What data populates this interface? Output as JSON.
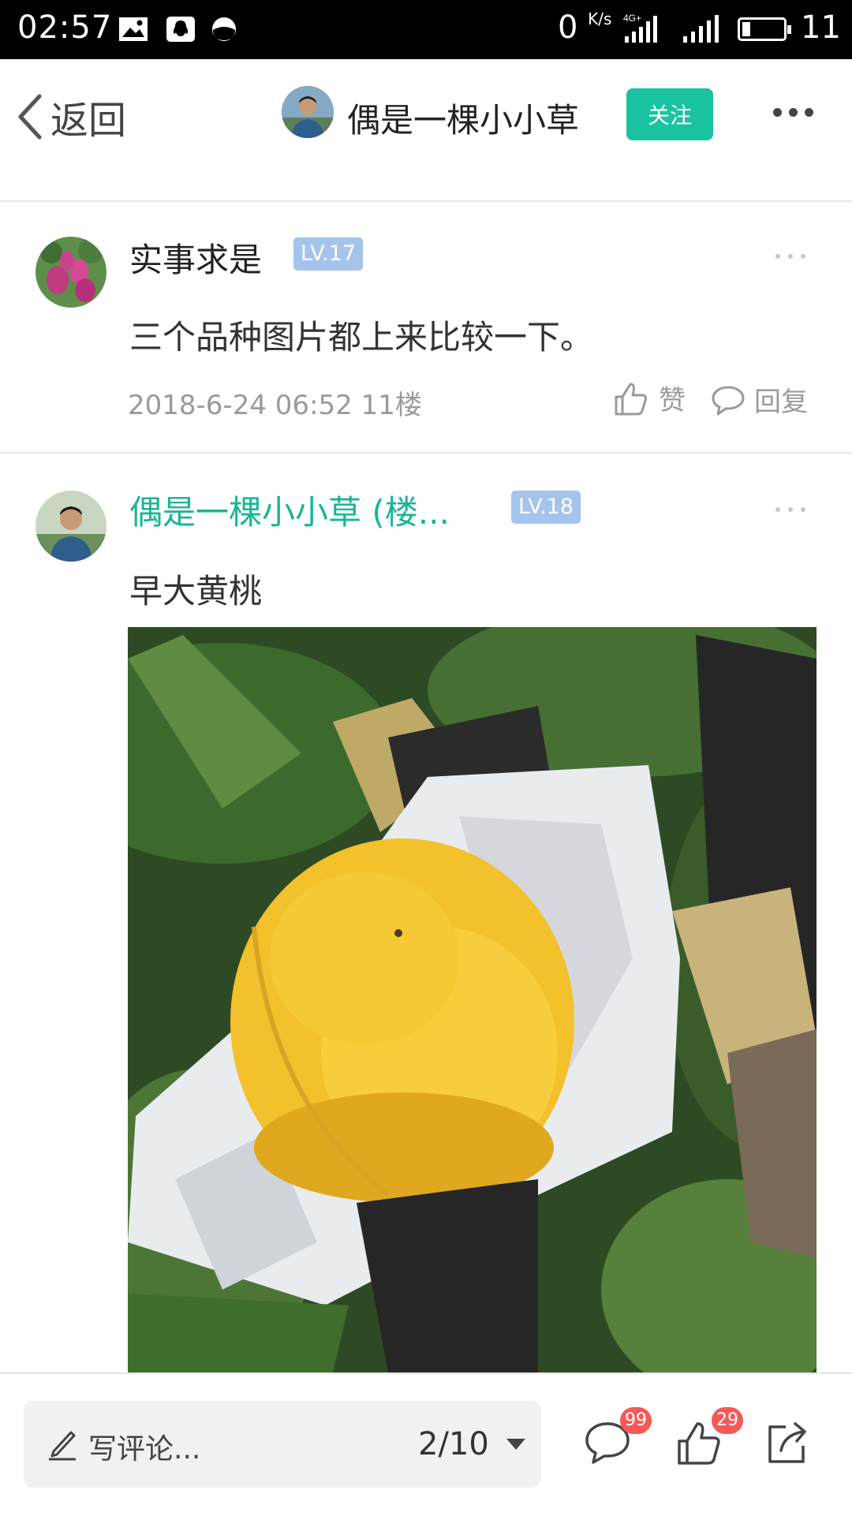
{
  "status_bar": {
    "time": "02:57",
    "net_speed": "0",
    "net_speed_unit": "K/s",
    "network": "4G",
    "battery": "11",
    "icons": [
      "image-icon",
      "qq-icon",
      "browser-icon",
      "signal-icon",
      "battery-icon"
    ]
  },
  "nav": {
    "back_label": "返回",
    "username": "偶是一棵小小草",
    "follow_label": "关注"
  },
  "posts": [
    {
      "user": "实事求是",
      "level": "LV.17",
      "content": "三个品种图片都上来比较一下。",
      "date": "2018-6-24 06:52",
      "floor": "11楼",
      "like_label": "赞",
      "reply_label": "回复"
    },
    {
      "user": "偶是一棵小小草 (楼...",
      "level": "LV.18",
      "content": "早大黄桃",
      "image": "yellow-peach-photo"
    }
  ],
  "bottom": {
    "comment_placeholder": "写评论...",
    "page_indicator": "2/10",
    "comment_count": "99",
    "like_count": "29"
  },
  "colors": {
    "accent": "#19c3a0",
    "level_badge": "#a4c4ec",
    "count_badge": "#f55a56",
    "author_name": "#19b597"
  }
}
